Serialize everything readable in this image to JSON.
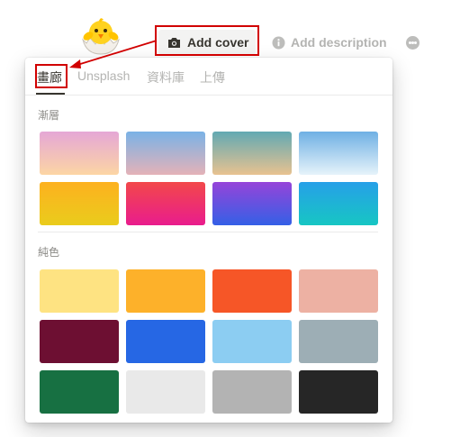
{
  "header": {
    "add_cover_label": "Add cover",
    "add_description_label": "Add description"
  },
  "picker": {
    "tabs": [
      {
        "label": "畫廊",
        "active": true
      },
      {
        "label": "Unsplash",
        "active": false
      },
      {
        "label": "資料庫",
        "active": false
      },
      {
        "label": "上傳",
        "active": false
      }
    ],
    "gradient_section_label": "漸層",
    "solid_section_label": "純色",
    "gradient_swatches": [
      {
        "name": "gradient-pink-peach",
        "colors": [
          "#e5a7d6",
          "#fcd5a4"
        ]
      },
      {
        "name": "gradient-blue-rose",
        "colors": [
          "#7ab2e6",
          "#e4b2b8"
        ]
      },
      {
        "name": "gradient-teal-sand",
        "colors": [
          "#62a9b3",
          "#e8c290"
        ]
      },
      {
        "name": "gradient-sky-white",
        "colors": [
          "#6fb0e4",
          "#e6f3fa"
        ]
      },
      {
        "name": "gradient-orange-yellow",
        "colors": [
          "#fdb11f",
          "#eacc1c"
        ]
      },
      {
        "name": "gradient-red-pink",
        "colors": [
          "#f2484a",
          "#e91c8d"
        ]
      },
      {
        "name": "gradient-purple-blue",
        "colors": [
          "#9644d9",
          "#3460e6"
        ]
      },
      {
        "name": "gradient-blue-cyan",
        "colors": [
          "#26a0e8",
          "#17c6c3"
        ]
      }
    ],
    "solid_swatches": [
      {
        "name": "solid-light-yellow",
        "color": "#fee382"
      },
      {
        "name": "solid-orange",
        "color": "#fdb12a"
      },
      {
        "name": "solid-red-orange",
        "color": "#f65627"
      },
      {
        "name": "solid-salmon",
        "color": "#edb1a3"
      },
      {
        "name": "solid-maroon",
        "color": "#6d0f32"
      },
      {
        "name": "solid-blue",
        "color": "#2667e4"
      },
      {
        "name": "solid-light-blue",
        "color": "#8ccdf2"
      },
      {
        "name": "solid-blue-gray",
        "color": "#9daeb5"
      },
      {
        "name": "solid-green",
        "color": "#177042"
      },
      {
        "name": "solid-light-gray",
        "color": "#e9e9e9"
      },
      {
        "name": "solid-gray",
        "color": "#b3b3b3"
      },
      {
        "name": "solid-black",
        "color": "#262626"
      }
    ]
  },
  "annotation_color": "#d10000"
}
